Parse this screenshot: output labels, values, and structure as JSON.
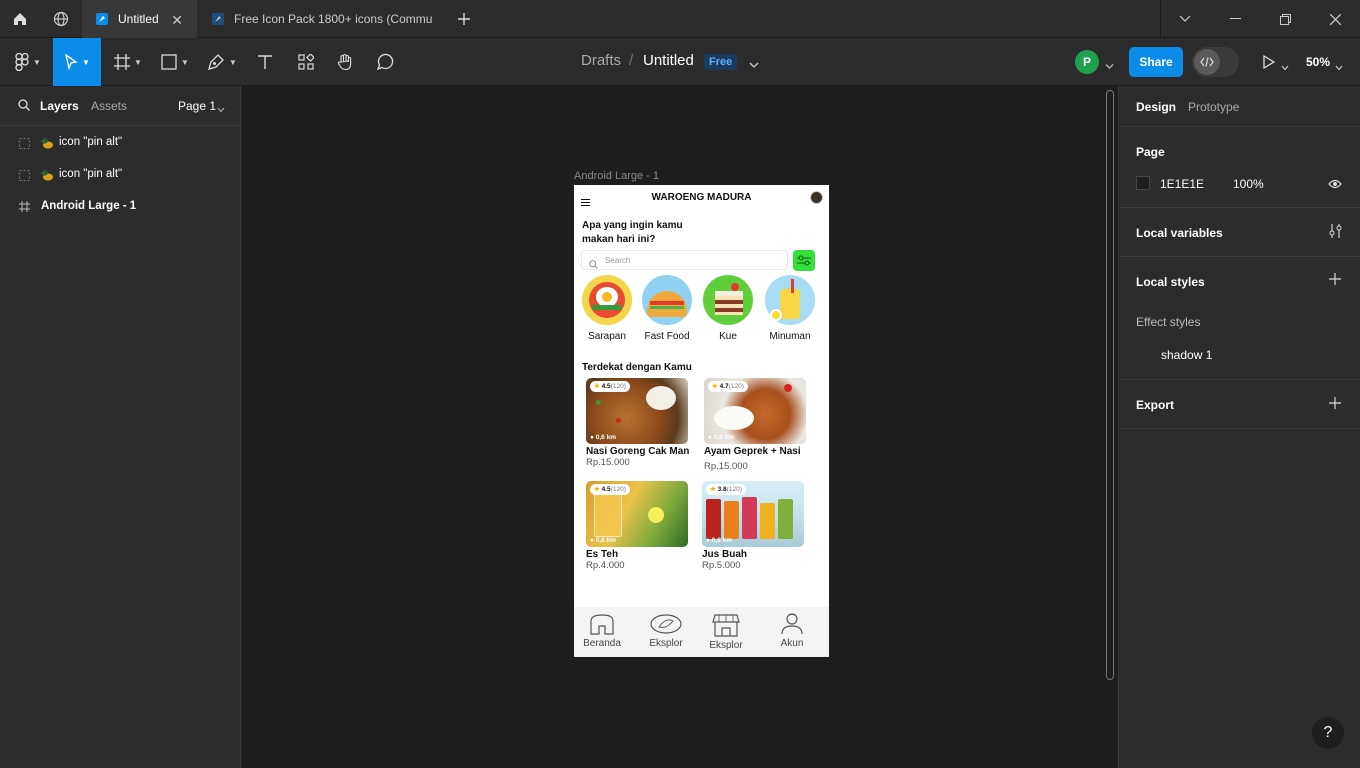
{
  "tabs": [
    {
      "label": "Untitled",
      "active": true
    },
    {
      "label": "Free Icon Pack 1800+ icons (Commu",
      "active": false
    }
  ],
  "toolbar": {
    "breadcrumb_parent": "Drafts",
    "breadcrumb_sep": "/",
    "file_name": "Untitled",
    "plan_badge": "Free",
    "avatar_initial": "P",
    "share_label": "Share",
    "zoom": "50%"
  },
  "left_panel": {
    "tab_layers": "Layers",
    "tab_assets": "Assets",
    "page_selector": "Page 1",
    "layers": [
      {
        "name": "icon \"pin alt\"",
        "type": "component"
      },
      {
        "name": "icon \"pin alt\"",
        "type": "component"
      },
      {
        "name": "Android Large - 1",
        "type": "frame"
      }
    ]
  },
  "right_panel": {
    "tab_design": "Design",
    "tab_prototype": "Prototype",
    "page_header": "Page",
    "page_color": "1E1E1E",
    "page_opacity": "100%",
    "local_variables": "Local variables",
    "local_styles": "Local styles",
    "effect_styles": "Effect styles",
    "effect_style_item": "shadow 1",
    "export": "Export",
    "help": "?"
  },
  "frame": {
    "label": "Android Large - 1",
    "app_title": "WAROENG MADURA",
    "greeting": "Apa yang ingin kamu makan hari ini?",
    "search_placeholder": "Search",
    "categories": [
      {
        "label": "Sarapan"
      },
      {
        "label": "Fast Food"
      },
      {
        "label": "Kue"
      },
      {
        "label": "Minuman"
      }
    ],
    "section_title": "Terdekat dengan Kamu",
    "items": [
      {
        "name": "Nasi Goreng Cak Man",
        "price": "Rp.15.000",
        "rating": "4.5",
        "count": "(120)",
        "distance": "0,6 km"
      },
      {
        "name": "Ayam Geprek + Nasi",
        "price": "Rp.15.000",
        "rating": "4.7",
        "count": "(120)",
        "distance": "0,8 km"
      },
      {
        "name": "Es Teh",
        "price": "Rp.4.000",
        "rating": "4.5",
        "count": "(120)",
        "distance": "0,6 km"
      },
      {
        "name": "Jus Buah",
        "price": "Rp.5.000",
        "rating": "3.8",
        "count": "(120)",
        "distance": "0,6 km"
      }
    ],
    "nav": [
      {
        "label": "Beranda"
      },
      {
        "label": "Eksplor"
      },
      {
        "label": "Eksplor"
      },
      {
        "label": "Akun"
      }
    ]
  },
  "colors": {
    "accent": "#0c8ce9",
    "filter_button": "#33e03a",
    "avatar": "#1fa04f"
  }
}
